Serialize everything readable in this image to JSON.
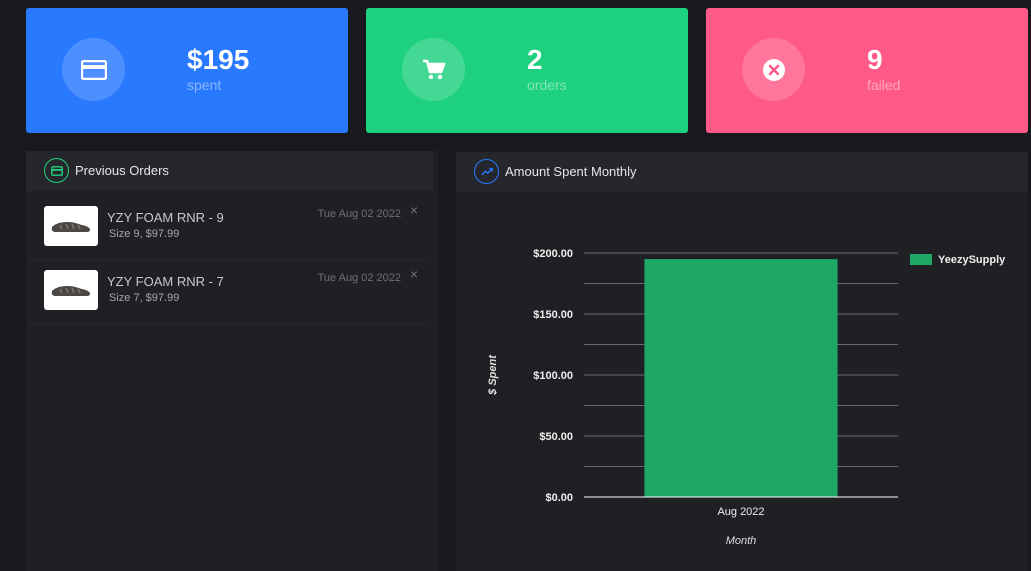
{
  "stats": [
    {
      "value": "$195",
      "label": "spent",
      "icon": "credit-card-icon",
      "color": "#2979ff"
    },
    {
      "value": "2",
      "label": "orders",
      "icon": "cart-icon",
      "color": "#1ed17f"
    },
    {
      "value": "9",
      "label": "failed",
      "icon": "x-circle-icon",
      "color": "#ff5a87"
    }
  ],
  "orders_panel": {
    "title": "Previous Orders",
    "items": [
      {
        "title": "YZY FOAM RNR - 9",
        "details": "Size 9, $97.99",
        "date": "Tue Aug 02 2022",
        "close": "×"
      },
      {
        "title": "YZY FOAM RNR - 7",
        "details": "Size 7, $97.99",
        "date": "Tue Aug 02 2022",
        "close": "×"
      }
    ]
  },
  "chart_panel": {
    "title": "Amount Spent Monthly"
  },
  "chart_data": {
    "type": "bar",
    "categories": [
      "Aug 2022"
    ],
    "series": [
      {
        "name": "YeezySupply",
        "values": [
          195
        ],
        "color": "#1ea866"
      }
    ],
    "xlabel": "Month",
    "ylabel": "$ Spent",
    "ylim": [
      0,
      200
    ],
    "yticks": [
      "$0.00",
      "$50.00",
      "$100.00",
      "$150.00",
      "$200.00"
    ],
    "grid": true,
    "legend": "top-right"
  }
}
